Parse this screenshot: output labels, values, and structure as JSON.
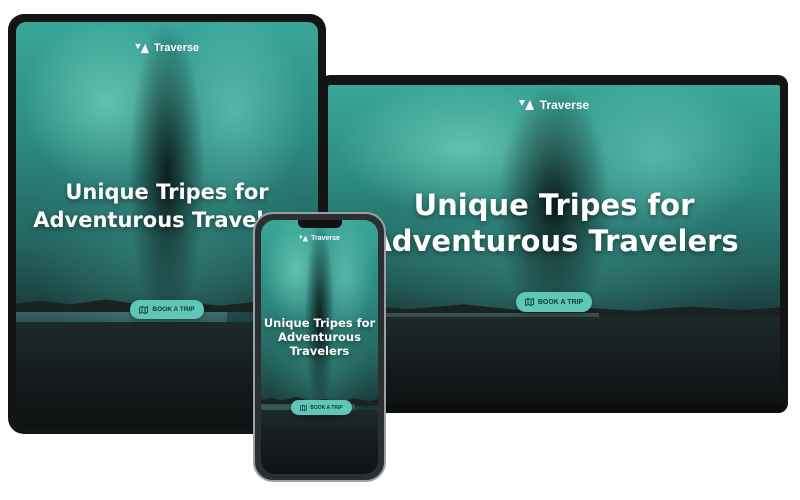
{
  "brand": {
    "name": "Traverse",
    "logo_icon": "traverse-logo-icon"
  },
  "hero": {
    "headline_line1": "Unique Tripes for",
    "headline_line2": "Adventurous Travelers",
    "phone_line1": "Unique Tripes for",
    "phone_line2": "Adventurous",
    "phone_line3": "Travelers",
    "cta_label": "BOOK A TRIP",
    "cta_icon": "map-icon"
  },
  "colors": {
    "accent": "#5fc7b6",
    "cta_text": "#0f3a35",
    "frame": "#121416"
  }
}
